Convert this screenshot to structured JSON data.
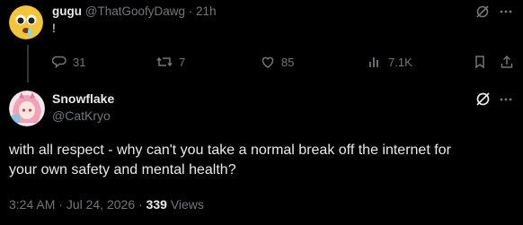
{
  "parent": {
    "display_name": "gugu",
    "handle": "@ThatGoofyDawg",
    "separator": "·",
    "time": "21h",
    "text": "!",
    "actions": {
      "replies": "31",
      "reposts": "7",
      "likes": "85",
      "views": "7.1K"
    }
  },
  "reply": {
    "display_name": "Snowflake",
    "handle": "@CatKryo",
    "text_line1": "with all respect - why can't you take a normal break off the internet for",
    "text_line2": "your own safety and mental health?",
    "meta": {
      "time": "3:24 AM",
      "sep1": "·",
      "date": "Jul 24, 2026",
      "sep2": "·",
      "views_count": "339",
      "views_label": "Views"
    }
  },
  "icons": {
    "reply": "reply-icon",
    "repost": "repost-icon",
    "like": "heart-icon",
    "views": "analytics-icon",
    "bookmark": "bookmark-icon",
    "share": "share-icon",
    "grok": "grok-icon",
    "more": "more-icon"
  }
}
